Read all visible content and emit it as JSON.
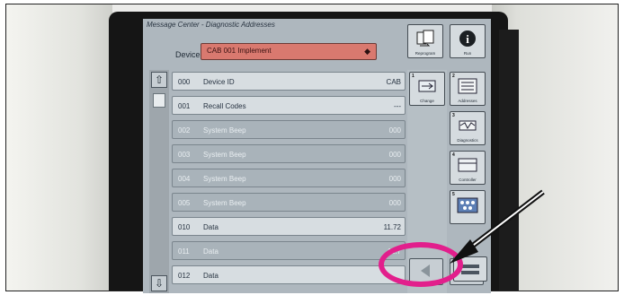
{
  "screen": {
    "title": "Message Center - Diagnostic Addresses",
    "device_label": "Device:",
    "device_value": "CAB 001    Implement"
  },
  "rows": [
    {
      "code": "000",
      "name": "Device ID",
      "value": "CAB"
    },
    {
      "code": "001",
      "name": "Recall Codes",
      "value": "---"
    },
    {
      "code": "002",
      "name": "System Beep",
      "value": "000"
    },
    {
      "code": "003",
      "name": "System Beep",
      "value": "000"
    },
    {
      "code": "004",
      "name": "System Beep",
      "value": "000"
    },
    {
      "code": "005",
      "name": "System Beep",
      "value": "000"
    },
    {
      "code": "010",
      "name": "Data",
      "value": "11.72"
    },
    {
      "code": "011",
      "name": "Data",
      "value": "11.7"
    },
    {
      "code": "012",
      "name": "Data",
      "value": ""
    }
  ],
  "icons": {
    "reprogram": "Reprogram",
    "run": "Run",
    "change": "Change",
    "addresses": "Addresses",
    "diagnostics": "Diagnostics",
    "controller": "Controller",
    "more": ""
  },
  "colors": {
    "annotation": "#e21f8c",
    "device_field": "#d9796f"
  }
}
